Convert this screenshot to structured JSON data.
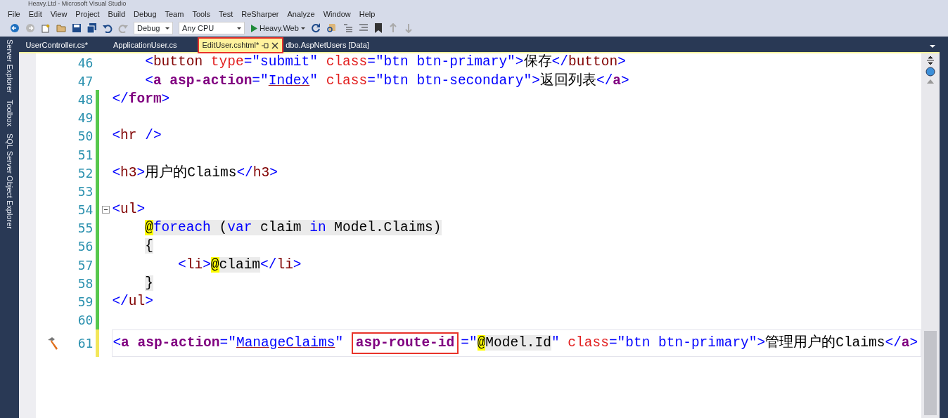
{
  "window": {
    "title": "Heavy.Ltd - Microsoft Visual Studio"
  },
  "menu": [
    "File",
    "Edit",
    "View",
    "Project",
    "Build",
    "Debug",
    "Team",
    "Tools",
    "Test",
    "ReSharper",
    "Analyze",
    "Window",
    "Help"
  ],
  "toolbar": {
    "configuration": "Debug",
    "platform": "Any CPU",
    "start_target": "Heavy.Web"
  },
  "dock_tabs": [
    "Server Explorer",
    "Toolbox",
    "SQL Server Object Explorer"
  ],
  "tabs": [
    {
      "label": "UserController.cs*",
      "selected": false,
      "annotated": false
    },
    {
      "label": "ApplicationUser.cs",
      "selected": false,
      "annotated": false
    },
    {
      "label": "EditUser.cshtml*",
      "selected": true,
      "annotated": true
    },
    {
      "label": "dbo.AspNetUsers [Data]",
      "selected": false,
      "annotated": false
    }
  ],
  "editor": {
    "lines": [
      {
        "number": "46",
        "tokens": [
          {
            "kind": "punct",
            "text": "    <"
          },
          {
            "kind": "element",
            "text": "button"
          },
          {
            "kind": "attr",
            "text": " type"
          },
          {
            "kind": "punct",
            "text": "="
          },
          {
            "kind": "value",
            "text": "\"submit\""
          },
          {
            "kind": "attr",
            "text": " class"
          },
          {
            "kind": "punct",
            "text": "="
          },
          {
            "kind": "value",
            "text": "\"btn btn-primary\""
          },
          {
            "kind": "punct",
            "text": ">"
          },
          {
            "kind": "text",
            "text": "保存"
          },
          {
            "kind": "punct",
            "text": "</"
          },
          {
            "kind": "element",
            "text": "button"
          },
          {
            "kind": "punct",
            "text": ">"
          }
        ]
      },
      {
        "number": "47",
        "tokens": [
          {
            "kind": "punct",
            "text": "    <"
          },
          {
            "kind": "helper",
            "text": "a"
          },
          {
            "kind": "helper",
            "text": " asp-action"
          },
          {
            "kind": "punct",
            "text": "=\""
          },
          {
            "kind": "value",
            "text": "Index",
            "underlined": true
          },
          {
            "kind": "punct",
            "text": "\""
          },
          {
            "kind": "attr",
            "text": " class"
          },
          {
            "kind": "punct",
            "text": "="
          },
          {
            "kind": "value",
            "text": "\"btn btn-secondary\""
          },
          {
            "kind": "punct",
            "text": ">"
          },
          {
            "kind": "text",
            "text": "返回列表"
          },
          {
            "kind": "punct",
            "text": "</"
          },
          {
            "kind": "helper",
            "text": "a"
          },
          {
            "kind": "punct",
            "text": ">"
          }
        ]
      },
      {
        "number": "48",
        "color": "#57c84d",
        "tokens": [
          {
            "kind": "punct",
            "text": "</"
          },
          {
            "kind": "helper",
            "text": "form"
          },
          {
            "kind": "punct",
            "text": ">"
          }
        ]
      },
      {
        "number": "49",
        "color": "#57c84d"
      },
      {
        "number": "50",
        "color": "#57c84d",
        "tokens": [
          {
            "kind": "punct",
            "text": "<"
          },
          {
            "kind": "element",
            "text": "hr"
          },
          {
            "kind": "punct",
            "text": " />"
          }
        ]
      },
      {
        "number": "51",
        "color": "#57c84d"
      },
      {
        "number": "52",
        "color": "#57c84d",
        "tokens": [
          {
            "kind": "punct",
            "text": "<"
          },
          {
            "kind": "element",
            "text": "h3"
          },
          {
            "kind": "punct",
            "text": ">"
          },
          {
            "kind": "text",
            "text": "用户的Claims"
          },
          {
            "kind": "punct",
            "text": "</"
          },
          {
            "kind": "element",
            "text": "h3"
          },
          {
            "kind": "punct",
            "text": ">"
          }
        ]
      },
      {
        "number": "53",
        "color": "#57c84d"
      },
      {
        "number": "54",
        "color": "#57c84d",
        "foldable": true,
        "tokens": [
          {
            "kind": "punct",
            "text": "<"
          },
          {
            "kind": "element",
            "text": "ul"
          },
          {
            "kind": "punct",
            "text": ">"
          }
        ]
      },
      {
        "number": "55",
        "color": "#57c84d",
        "tokens": [
          {
            "kind": "at",
            "text": "    @"
          },
          {
            "kind": "keyword",
            "text": "foreach"
          },
          {
            "kind": "csharp",
            "text": " ("
          },
          {
            "kind": "keyword",
            "text": "var"
          },
          {
            "kind": "csharp",
            "text": " claim "
          },
          {
            "kind": "keyword",
            "text": "in"
          },
          {
            "kind": "csharp",
            "text": " Model.Claims)"
          }
        ]
      },
      {
        "number": "56",
        "color": "#57c84d",
        "tokens": [
          {
            "kind": "csharp",
            "text": "    {"
          }
        ]
      },
      {
        "number": "57",
        "color": "#57c84d",
        "tokens": [
          {
            "kind": "punct",
            "text": "        <"
          },
          {
            "kind": "element",
            "text": "li"
          },
          {
            "kind": "punct",
            "text": ">"
          },
          {
            "kind": "at",
            "text": "@"
          },
          {
            "kind": "csharp",
            "text": "claim"
          },
          {
            "kind": "punct",
            "text": "</"
          },
          {
            "kind": "element",
            "text": "li"
          },
          {
            "kind": "punct",
            "text": ">"
          }
        ]
      },
      {
        "number": "58",
        "color": "#57c84d",
        "tokens": [
          {
            "kind": "csharp",
            "text": "    }"
          }
        ]
      },
      {
        "number": "59",
        "color": "#57c84d",
        "tokens": [
          {
            "kind": "punct",
            "text": "</"
          },
          {
            "kind": "element",
            "text": "ul"
          },
          {
            "kind": "punct",
            "text": ">"
          }
        ]
      },
      {
        "number": "60",
        "color": "#57c84d"
      },
      {
        "number": "61",
        "color": "#f3e75a",
        "current": true,
        "build_marker": true,
        "tokens": [
          {
            "kind": "punct",
            "text": "<"
          },
          {
            "kind": "helper",
            "text": "a"
          },
          {
            "kind": "helper",
            "text": " asp-action"
          },
          {
            "kind": "punct",
            "text": "=\""
          },
          {
            "kind": "value",
            "text": "ManageClaims",
            "underlined": true
          },
          {
            "kind": "punct",
            "text": "\" "
          },
          {
            "kind": "helper",
            "text": "asp-route-id",
            "annotated": true
          },
          {
            "kind": "punct",
            "text": "=\""
          },
          {
            "kind": "at",
            "text": "@"
          },
          {
            "kind": "csharp",
            "text": "Model.Id"
          },
          {
            "kind": "punct",
            "text": "\""
          },
          {
            "kind": "attr",
            "text": " class"
          },
          {
            "kind": "punct",
            "text": "="
          },
          {
            "kind": "value",
            "text": "\"btn btn-primary\""
          },
          {
            "kind": "punct",
            "text": ">"
          },
          {
            "kind": "text",
            "text": "管理用户的Claims"
          },
          {
            "kind": "punct",
            "text": "</"
          },
          {
            "kind": "helper",
            "text": "a"
          },
          {
            "kind": "punct",
            "text": ">"
          }
        ]
      }
    ]
  }
}
